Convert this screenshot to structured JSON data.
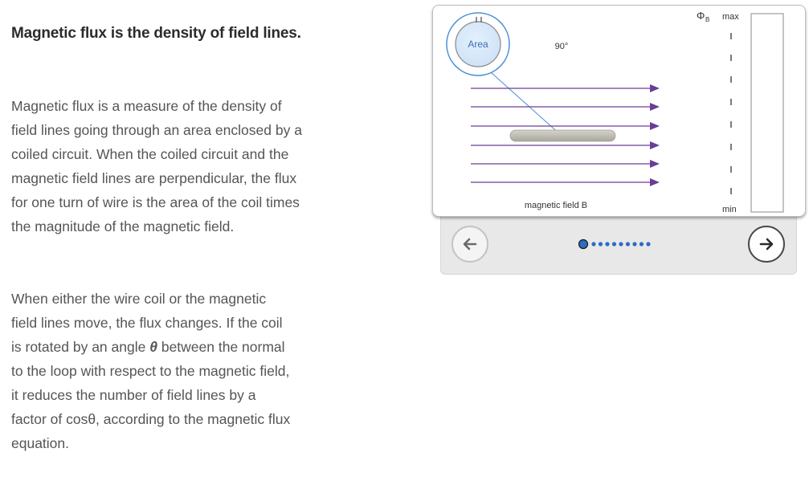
{
  "article": {
    "heading": "Magnetic flux is the density of field lines.",
    "para1": "Magnetic flux is a measure of the density of field lines going through an area enclosed by a coiled circuit. When the coiled circuit and the magnetic field lines are perpendicular, the flux for one turn of wire is the area of the coil times the magnitude of the magnetic field.",
    "para2_before": "When either the wire coil or the magnetic field lines move, the flux changes. If the coil is rotated by an angle ",
    "para2_symbol": "θ",
    "para2_after": " between the normal to the loop with respect to the magnetic field, it reduces the number of field lines by a factor of cosθ, according to the magnetic flux equation."
  },
  "animation": {
    "area_label": "Area",
    "angle_label": "90°",
    "field_label": "magnetic field B",
    "meter": {
      "symbol": "Φ",
      "subscript": "B",
      "max_label": "max",
      "min_label": "min",
      "level": 0
    },
    "steps_total": 10,
    "current_step": 1,
    "colors": {
      "field_lines": "#6a3d96",
      "area_circle": "#4a90d6",
      "area_fill": "#cfe3f7",
      "coil": "#bdbab0"
    }
  },
  "controls": {
    "back_icon": "arrow-left-icon",
    "next_icon": "arrow-right-icon"
  }
}
